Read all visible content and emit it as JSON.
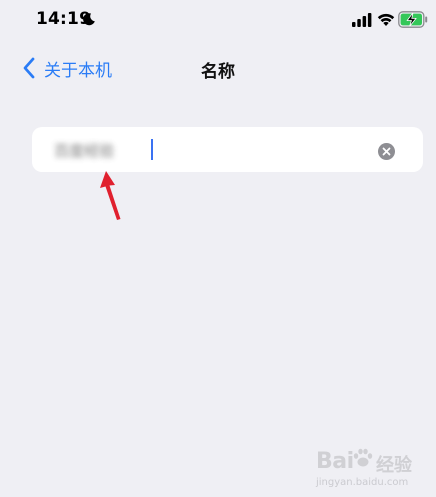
{
  "status_bar": {
    "time": "14:19",
    "icons": [
      "moon-icon",
      "cellular-signal-icon",
      "wifi-icon",
      "battery-charging-icon"
    ]
  },
  "nav": {
    "back_label": "关于本机",
    "title": "名称"
  },
  "name_field": {
    "value": "百度经验",
    "clear_icon": "clear-circle-icon"
  },
  "annotation": {
    "arrow_color": "#e0202e"
  },
  "watermark": {
    "brand": "Bai",
    "brand_suffix": "经验",
    "url": "jingyan.baidu.com"
  },
  "colors": {
    "background": "#efeff4",
    "accent": "#2a7cf6",
    "field_background": "#ffffff",
    "caret": "#3a72f2"
  }
}
